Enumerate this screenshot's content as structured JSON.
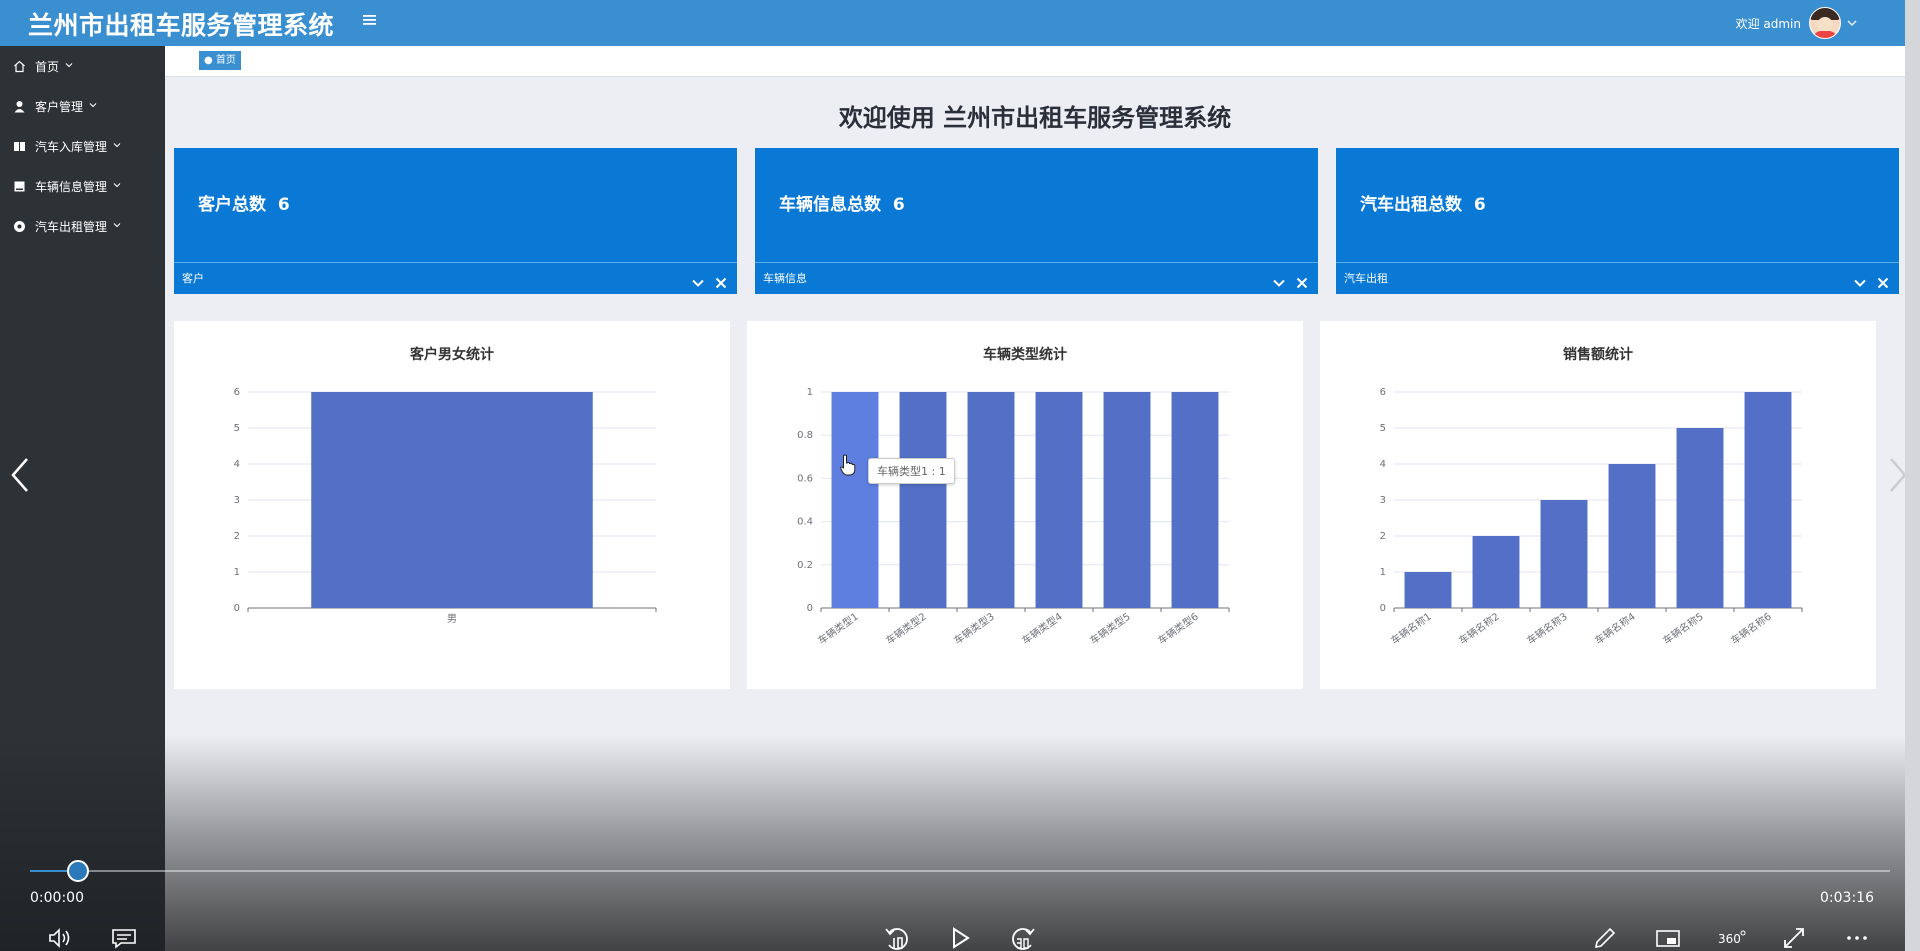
{
  "header": {
    "app_title": "兰州市出租车服务管理系统",
    "welcome_user": "欢迎 admin",
    "menu_icon": "hamburger-icon",
    "avatar_icon": "user-avatar-icon"
  },
  "sidebar": {
    "items": [
      {
        "label": "首页",
        "icon": "home-icon"
      },
      {
        "label": "客户管理",
        "icon": "person-icon"
      },
      {
        "label": "汽车入库管理",
        "icon": "book-icon"
      },
      {
        "label": "车辆信息管理",
        "icon": "square-icon"
      },
      {
        "label": "汽车出租管理",
        "icon": "dot-circle-icon"
      }
    ]
  },
  "tabs": {
    "home": "● 首页"
  },
  "main": {
    "welcome_title": "欢迎使用 兰州市出租车服务管理系统"
  },
  "stat_cards": [
    {
      "title": "客户总数",
      "value": "6",
      "footer": "客户"
    },
    {
      "title": "车辆信息总数",
      "value": "6",
      "footer": "车辆信息"
    },
    {
      "title": "汽车出租总数",
      "value": "6",
      "footer": "汽车出租"
    }
  ],
  "colors": {
    "header": "#3a8fd0",
    "sidebar": "#2d3237",
    "stat_card": "#0a79d6",
    "bar": "#5470c6",
    "bar_highlight": "#5e7fe0"
  },
  "tooltip": {
    "text": "车辆类型1 : 1"
  },
  "video": {
    "current_time": "0:00:00",
    "total_time": "0:03:16",
    "progress": 0.026,
    "controls": [
      "volume-icon",
      "subtitles-icon",
      "rewind-10-icon",
      "play-icon",
      "forward-30-icon",
      "pen-icon",
      "picture-in-picture-icon",
      "360-icon",
      "fullscreen-icon",
      "more-icon"
    ]
  },
  "chart_data": [
    {
      "type": "bar",
      "title": "客户男女统计",
      "categories": [
        "男"
      ],
      "values": [
        6
      ],
      "ylim": [
        0,
        6
      ],
      "yticks": [
        "0",
        "1",
        "2",
        "3",
        "4",
        "5",
        "6"
      ],
      "grid": true
    },
    {
      "type": "bar",
      "title": "车辆类型统计",
      "categories": [
        "车辆类型1",
        "车辆类型2",
        "车辆类型3",
        "车辆类型4",
        "车辆类型5",
        "车辆类型6"
      ],
      "values": [
        1,
        1,
        1,
        1,
        1,
        1
      ],
      "ylim": [
        0,
        1
      ],
      "yticks": [
        "0",
        "0.2",
        "0.4",
        "0.6",
        "0.8",
        "1"
      ],
      "grid": true
    },
    {
      "type": "bar",
      "title": "销售额统计",
      "categories": [
        "车辆名称1",
        "车辆名称2",
        "车辆名称3",
        "车辆名称4",
        "车辆名称5",
        "车辆名称6"
      ],
      "values": [
        1,
        2,
        3,
        4,
        5,
        6
      ],
      "ylim": [
        0,
        6
      ],
      "yticks": [
        "0",
        "1",
        "2",
        "3",
        "4",
        "5",
        "6"
      ],
      "grid": true
    }
  ]
}
